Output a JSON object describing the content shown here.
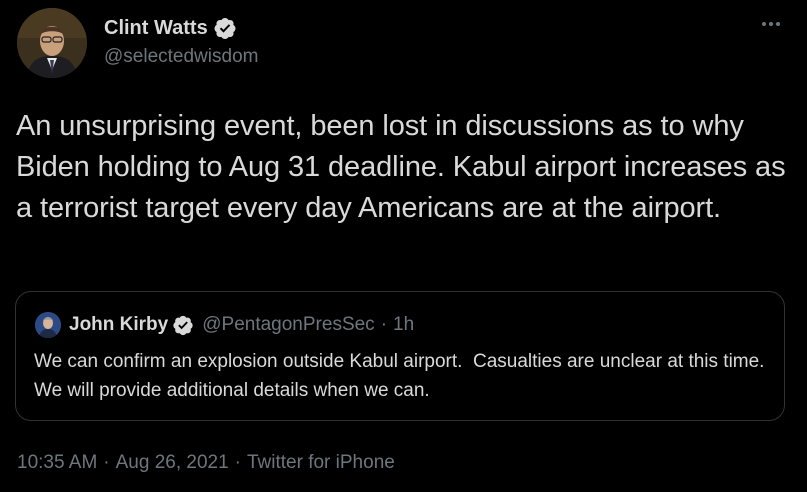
{
  "author": {
    "display_name": "Clint Watts",
    "handle": "@selectedwisdom",
    "verified": true,
    "avatar_icon": "profile-photo"
  },
  "tweet": {
    "text": "An unsurprising event, been lost in discussions as to why Biden holding to Aug 31 deadline. Kabul airport increases as a terrorist target every day Americans are at the airport."
  },
  "quoted_tweet": {
    "display_name": "John Kirby",
    "handle": "@PentagonPresSec",
    "separator": "·",
    "time": "1h",
    "verified": true,
    "text": "We can confirm an explosion outside Kabul airport.  Casualties are unclear at this time.  We will provide additional details when we can."
  },
  "footer": {
    "time": "10:35 AM",
    "separator": "·",
    "date": "Aug 26, 2021",
    "source": "Twitter for iPhone"
  },
  "colors": {
    "background": "#000000",
    "primary_text": "#d9d9d9",
    "secondary_text": "#6e767d",
    "border": "#2f3336",
    "verified_badge": "#d9d9d9"
  }
}
